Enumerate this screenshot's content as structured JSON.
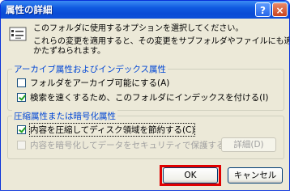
{
  "window": {
    "title": "属性の詳細",
    "help_label": "?",
    "close_label": "×"
  },
  "description": {
    "line1": "このフォルダに使用するオプションを選択してください。",
    "line2": "これらの変更を適用すると、その変更をサブフォルダやファイルにも適用するかどう",
    "line3": "かたずねられます。"
  },
  "archive_group": {
    "label": "アーカイブ属性およびインデックス属性",
    "archive_option": "フォルダをアーカイブ可能にする(A)",
    "archive_checked": false,
    "index_option": "検索を速くするため、このフォルダにインデックスを付ける(I)",
    "index_checked": true
  },
  "compress_group": {
    "label": "圧縮属性または暗号化属性",
    "compress_option": "内容を圧縮してディスク領域を節約する(C)",
    "compress_checked": true,
    "encrypt_option": "内容を暗号化してデータをセキュリティで保護する(E)",
    "encrypt_checked": false,
    "details_label": "詳細(D)"
  },
  "buttons": {
    "ok_label": "OK",
    "cancel_label": "キャンセル"
  },
  "colors": {
    "title_bar": "#0a4cd6",
    "group_label": "#0046d5",
    "highlight": "#e00000"
  }
}
